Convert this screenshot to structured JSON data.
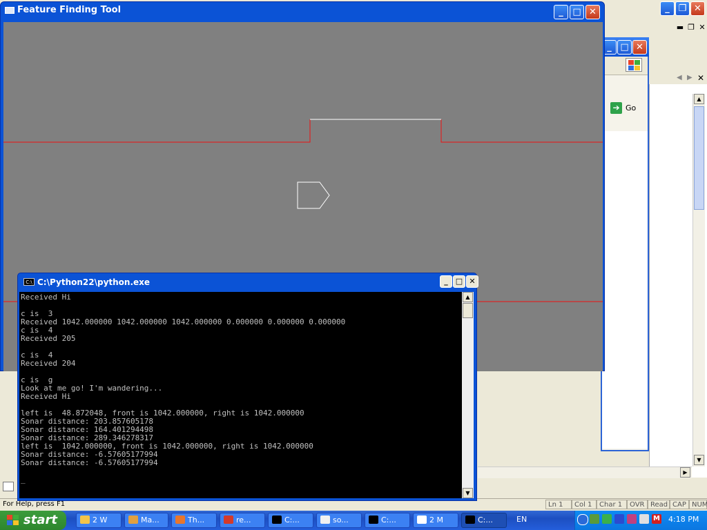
{
  "feature_tool": {
    "title": "Feature Finding Tool",
    "controls": [
      "_",
      "□",
      "✕"
    ]
  },
  "console": {
    "title": "C:\\Python22\\python.exe",
    "icon_text": "C:\\",
    "controls": [
      "_",
      "□",
      "✕"
    ],
    "lines": [
      "Received Hi",
      "",
      "c is  3",
      "Received 1042.000000 1042.000000 1042.000000 0.000000 0.000000 0.000000",
      "c is  4",
      "Received 205",
      "",
      "c is  4",
      "Received 204",
      "",
      "c is  g",
      "Look at me go! I'm wandering...",
      "Received Hi",
      "",
      "left is  48.872048, front is 1042.000000, right is 1042.000000",
      "Sonar distance: 203.857605178",
      "Sonar distance: 164.401294498",
      "Sonar distance: 289.346278317",
      "left is  1042.000000, front is 1042.000000, right is 1042.000000",
      "Sonar distance: -6.57605177994",
      "Sonar distance: -6.57605177994",
      "",
      "_"
    ]
  },
  "background_app": {
    "go_label": "Go",
    "status_help": "For Help, press F1",
    "status_cells": [
      "Ln 1",
      "Col 1",
      "Char 1",
      "OVR",
      "Read",
      "CAP",
      "NUM"
    ]
  },
  "taskbar": {
    "start_label": "start",
    "tasks": [
      {
        "label": "2 W",
        "icon": "folder-icon",
        "color": "#f3c44a"
      },
      {
        "label": "Ma...",
        "icon": "app-icon",
        "color": "#e0a040"
      },
      {
        "label": "Th...",
        "icon": "firefox-icon",
        "color": "#e8762c"
      },
      {
        "label": "re...",
        "icon": "tk-icon",
        "color": "#d43a2a"
      },
      {
        "label": "C:...",
        "icon": "console-icon",
        "color": "#000000"
      },
      {
        "label": "so...",
        "icon": "java-icon",
        "color": "#f0f0f0"
      },
      {
        "label": "C:...",
        "icon": "console-icon",
        "color": "#000000"
      },
      {
        "label": "2 M",
        "icon": "window-icon",
        "color": "#ffffff"
      },
      {
        "label": "C:...",
        "icon": "console-icon",
        "color": "#000000"
      }
    ],
    "language": "EN",
    "clock": "4:18 PM"
  }
}
